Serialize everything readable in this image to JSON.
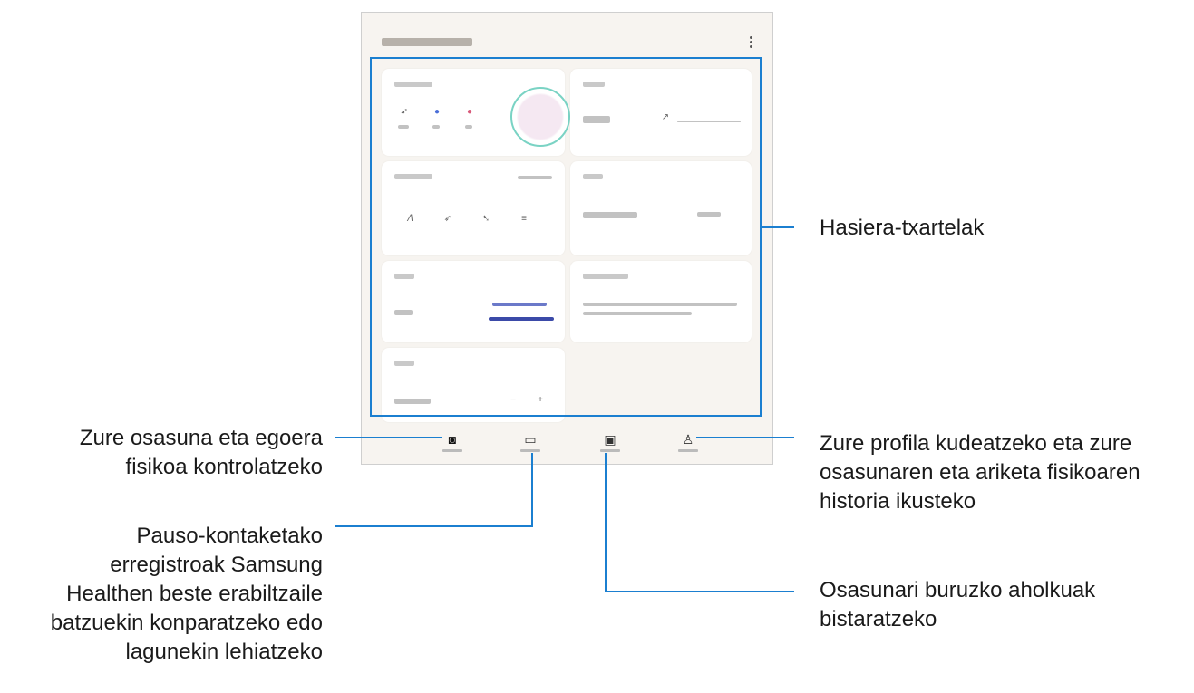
{
  "phone": {
    "nav": {
      "home_icon": "camera-icon",
      "together_icon": "chat-icon",
      "discover_icon": "gallery-icon",
      "my_page_icon": "person-icon"
    }
  },
  "callouts": {
    "home_cards": "Hasiera-txartelak",
    "home_tab": [
      "Zure osasuna eta egoera",
      "fisikoa kontrolatzeko"
    ],
    "together_tab": [
      "Pauso-kontaketako",
      "erregistroak Samsung",
      "Healthen beste erabiltzaile",
      "batzuekin konparatzeko edo",
      "lagunekin lehiatzeko"
    ],
    "discover_tab": [
      "Osasunari buruzko aholkuak",
      "bistaratzeko"
    ],
    "my_page_tab": [
      "Zure profila kudeatzeko eta zure",
      "osasunaren eta ariketa fisikoaren",
      "historia ikusteko"
    ]
  },
  "colors": {
    "accent": "#1b7fd0",
    "card_bg": "#ffffff",
    "screen_bg": "#f7f4f0"
  }
}
